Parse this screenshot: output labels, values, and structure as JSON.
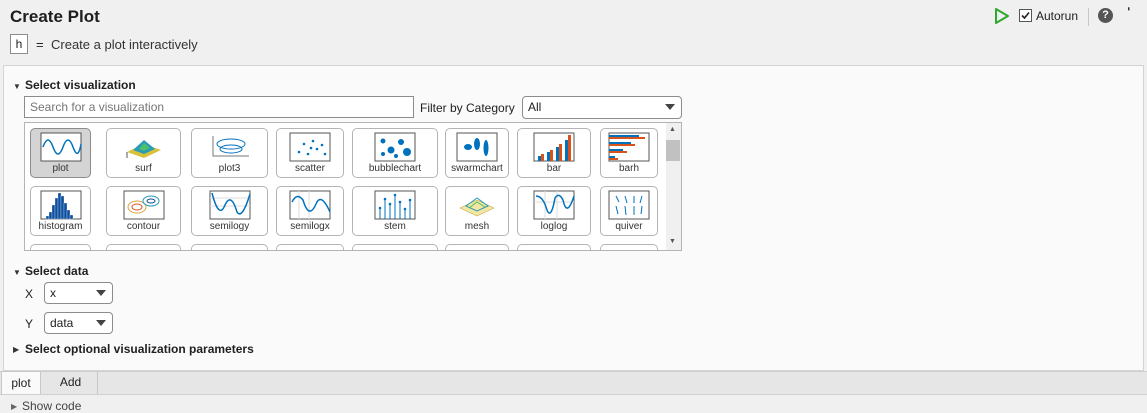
{
  "header": {
    "title": "Create Plot",
    "output_var": "h",
    "equals": "=",
    "description": "Create a plot interactively",
    "autorun_label": "Autorun",
    "autorun_checked": true,
    "help_glyph": "?",
    "more_glyph": "..."
  },
  "select_visualization": {
    "heading": "Select visualization",
    "search_placeholder": "Search for a visualization",
    "filter_label": "Filter by Category",
    "filter_value": "All",
    "items": [
      {
        "label": "plot",
        "icon": "plot-icon",
        "selected": true
      },
      {
        "label": "surf",
        "icon": "surf-icon"
      },
      {
        "label": "plot3",
        "icon": "plot3-icon"
      },
      {
        "label": "scatter",
        "icon": "scatter-icon"
      },
      {
        "label": "bubblechart",
        "icon": "bubblechart-icon"
      },
      {
        "label": "swarmchart",
        "icon": "swarmchart-icon"
      },
      {
        "label": "bar",
        "icon": "bar-icon"
      },
      {
        "label": "barh",
        "icon": "barh-icon"
      },
      {
        "label": "histogram",
        "icon": "histogram-icon"
      },
      {
        "label": "contour",
        "icon": "contour-icon"
      },
      {
        "label": "semilogy",
        "icon": "semilogy-icon"
      },
      {
        "label": "semilogx",
        "icon": "semilogx-icon"
      },
      {
        "label": "stem",
        "icon": "stem-icon"
      },
      {
        "label": "mesh",
        "icon": "mesh-icon"
      },
      {
        "label": "loglog",
        "icon": "loglog-icon"
      },
      {
        "label": "quiver",
        "icon": "quiver-icon"
      }
    ]
  },
  "select_data": {
    "heading": "Select data",
    "x_label": "X",
    "x_value": "x",
    "y_label": "Y",
    "y_value": "data"
  },
  "optional_params": {
    "heading": "Select optional visualization parameters"
  },
  "tabs": [
    {
      "label": "plot",
      "active": true
    },
    {
      "label": "Add",
      "active": false
    }
  ],
  "footer": {
    "show_code": "Show code"
  },
  "colors": {
    "accent_blue": "#0072bd",
    "orange": "#d95319",
    "run_green": "#2fa82f"
  }
}
